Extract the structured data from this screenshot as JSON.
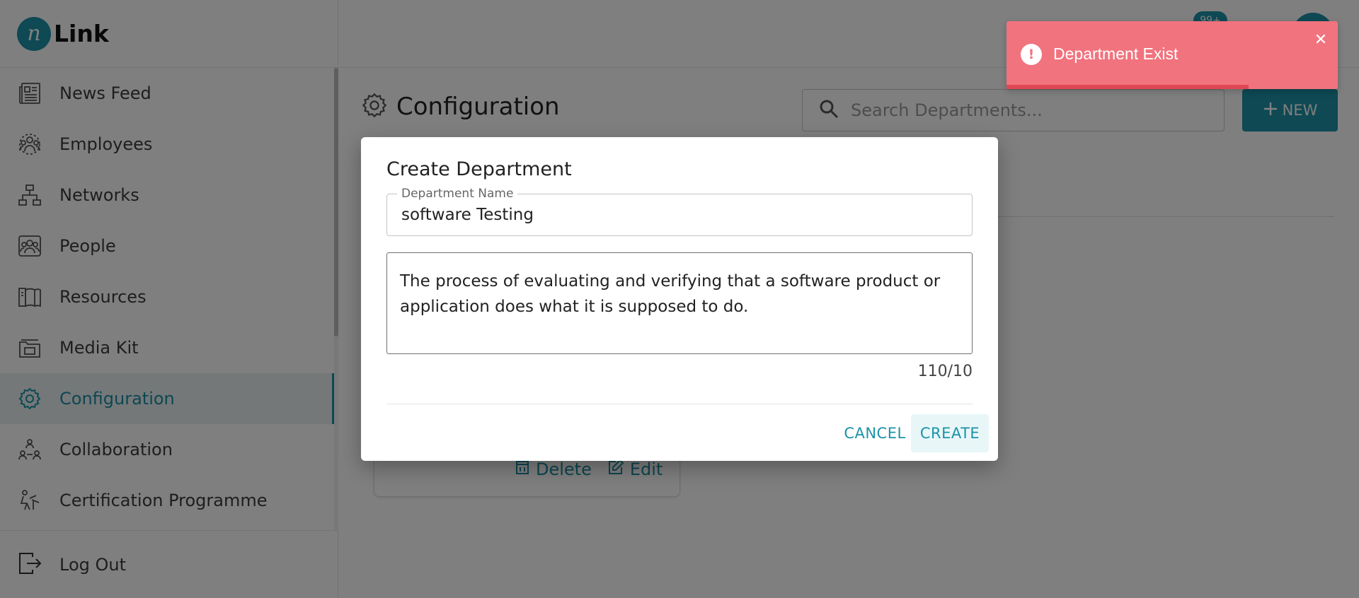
{
  "app": {
    "logo_letter": "n",
    "logo_text": "Link"
  },
  "sidebar": {
    "items": [
      {
        "label": "News Feed",
        "icon": "newspaper-icon"
      },
      {
        "label": "Employees",
        "icon": "employees-icon"
      },
      {
        "label": "Networks",
        "icon": "network-icon"
      },
      {
        "label": "People",
        "icon": "people-icon"
      },
      {
        "label": "Resources",
        "icon": "book-icon"
      },
      {
        "label": "Media Kit",
        "icon": "media-kit-icon"
      },
      {
        "label": "Configuration",
        "icon": "gear-icon",
        "active": true
      },
      {
        "label": "Collaboration",
        "icon": "collaboration-icon"
      },
      {
        "label": "Certification Programme",
        "icon": "certification-icon"
      }
    ],
    "logout_label": "Log Out"
  },
  "topbar": {
    "notification_badge": "99+"
  },
  "main": {
    "page_title": "Configuration",
    "search_placeholder": "Search Departments...",
    "new_button_label": "NEW",
    "card": {
      "delete_label": "Delete",
      "edit_label": "Edit"
    }
  },
  "modal": {
    "title": "Create Department",
    "name_label": "Department Name",
    "name_value": "software Testing",
    "description_value": "The process of evaluating and verifying that a software product or application does what it is supposed to do.",
    "char_counter": "110/10",
    "cancel_label": "CANCEL",
    "create_label": "CREATE"
  },
  "toast": {
    "message": "Department Exist",
    "type": "error",
    "progress": 0.73,
    "color": "#f1737e"
  },
  "colors": {
    "accent": "#1c93a8",
    "active_bg": "#e8f1f3"
  }
}
